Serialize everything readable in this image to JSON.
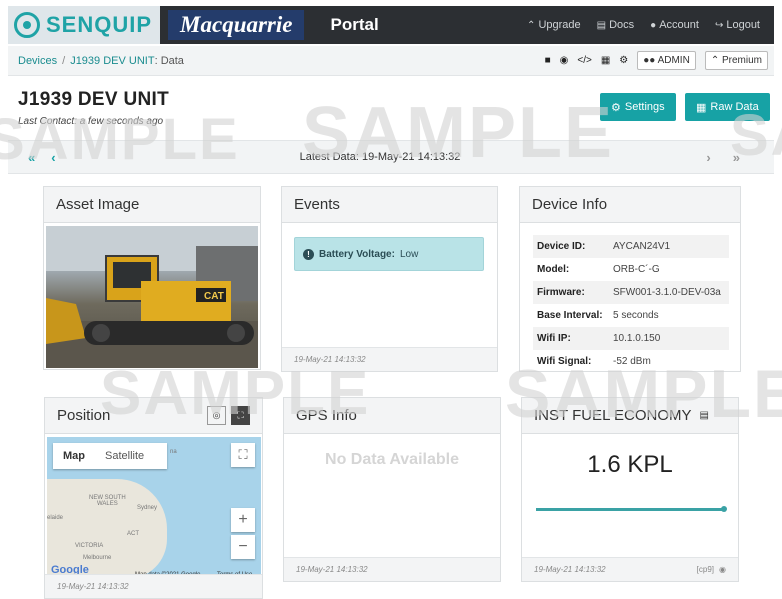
{
  "brand": {
    "senquip": "SENQUIP",
    "macquarrie": "Macquarrie",
    "portal": "Portal"
  },
  "nav": {
    "upgrade": "Upgrade",
    "docs": "Docs",
    "account": "Account",
    "logout": "Logout"
  },
  "breadcrumb": {
    "devices": "Devices",
    "device": "J1939 DEV UNIT",
    "page": "Data"
  },
  "toolbar": {
    "admin": "ADMIN",
    "premium": "Premium"
  },
  "page": {
    "title": "J1939 DEV UNIT",
    "last_contact": "Last Contact: a few seconds ago"
  },
  "buttons": {
    "settings": "Settings",
    "raw_data": "Raw Data"
  },
  "data_nav": {
    "latest": "Latest Data: 19-May-21 14:13:32"
  },
  "asset": {
    "title": "Asset Image"
  },
  "events": {
    "title": "Events",
    "alert_label": "Battery Voltage:",
    "alert_value": "Low",
    "footer": "19-May-21 14:13:32"
  },
  "device_info": {
    "title": "Device Info",
    "rows": [
      {
        "key": "Device ID:",
        "value": "AYCAN24V1"
      },
      {
        "key": "Model:",
        "value": "ORB-C´-G"
      },
      {
        "key": "Firmware:",
        "value": "SFW001-3.1.0-DEV-03a"
      },
      {
        "key": "Base Interval:",
        "value": "5 seconds"
      },
      {
        "key": "Wifi IP:",
        "value": "10.1.0.150"
      },
      {
        "key": "Wifi Signal:",
        "value": "-52 dBm"
      }
    ]
  },
  "position": {
    "title": "Position",
    "tab_map": "Map",
    "tab_satellite": "Satellite",
    "labels": {
      "nsw": "NEW SOUTH\nWALES",
      "sydney": "Sydney",
      "adelaide": "elaide",
      "act": "ACT",
      "victoria": "VICTORIA",
      "melbourne": "Melbourne",
      "frag": "na"
    },
    "credit": "Map data ©2021 Google",
    "terms": "Terms of Use",
    "google": "Google",
    "footer": "19-May-21 14:13:32"
  },
  "gps": {
    "title": "GPS Info",
    "empty": "No Data Available",
    "footer": "19-May-21 14:13:32"
  },
  "fuel": {
    "title": "INST FUEL ECONOMY",
    "value": "1.6 KPL",
    "footer": "19-May-21 14:13:32",
    "tag": "[cp9]"
  },
  "watermark": "SAMPLE"
}
